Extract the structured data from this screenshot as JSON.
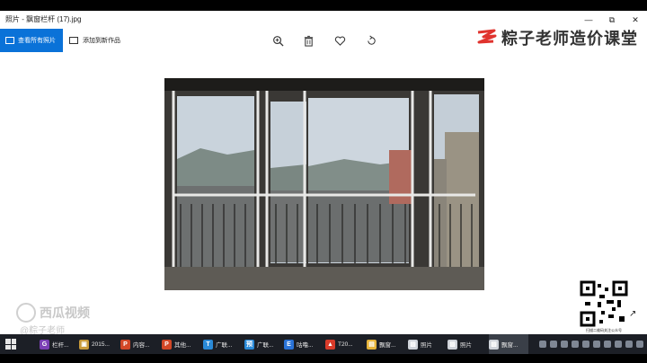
{
  "window": {
    "title": "照片 - 飘窗栏杆 (17).jpg",
    "minimize_label": "—",
    "restore_label": "⧉",
    "close_label": "✕"
  },
  "toolbar": {
    "view_all_label": "查看所有照片",
    "add_to_creation_label": "添加到新作品",
    "tools": [
      "zoom-icon",
      "delete-icon",
      "favorite-icon",
      "rotate-icon"
    ]
  },
  "branding": {
    "name": "粽子老师造价课堂",
    "accent": "#e0332e"
  },
  "watermark": {
    "brand": "西瓜视频",
    "handle": "@粽子老师"
  },
  "qr": {
    "caption": "扫描二维码关注公众号"
  },
  "taskbar": {
    "items": [
      {
        "label": "栏杆...",
        "icon": "G",
        "color": "#7b3fb5"
      },
      {
        "label": "2015...",
        "icon": "▣",
        "color": "#c79a3a"
      },
      {
        "label": "内容...",
        "icon": "P",
        "color": "#d24726"
      },
      {
        "label": "其他...",
        "icon": "P",
        "color": "#d24726"
      },
      {
        "label": "广联...",
        "icon": "T",
        "color": "#2a8ad8"
      },
      {
        "label": "广联...",
        "icon": "预",
        "color": "#2a8ad8"
      },
      {
        "label": "咕噜...",
        "icon": "E",
        "color": "#2a73d8"
      },
      {
        "label": "T20...",
        "icon": "▲",
        "color": "#d83b2a"
      },
      {
        "label": "飘窗...",
        "icon": "▤",
        "color": "#e6b43a"
      },
      {
        "label": "照片",
        "icon": "▨",
        "color": "#cfd3da"
      },
      {
        "label": "照片",
        "icon": "▨",
        "color": "#cfd3da"
      },
      {
        "label": "飘窗...",
        "icon": "▨",
        "color": "#cfd3da"
      }
    ]
  },
  "colors": {
    "accent_blue": "#0a72d8",
    "taskbar": "#1c1f26"
  }
}
